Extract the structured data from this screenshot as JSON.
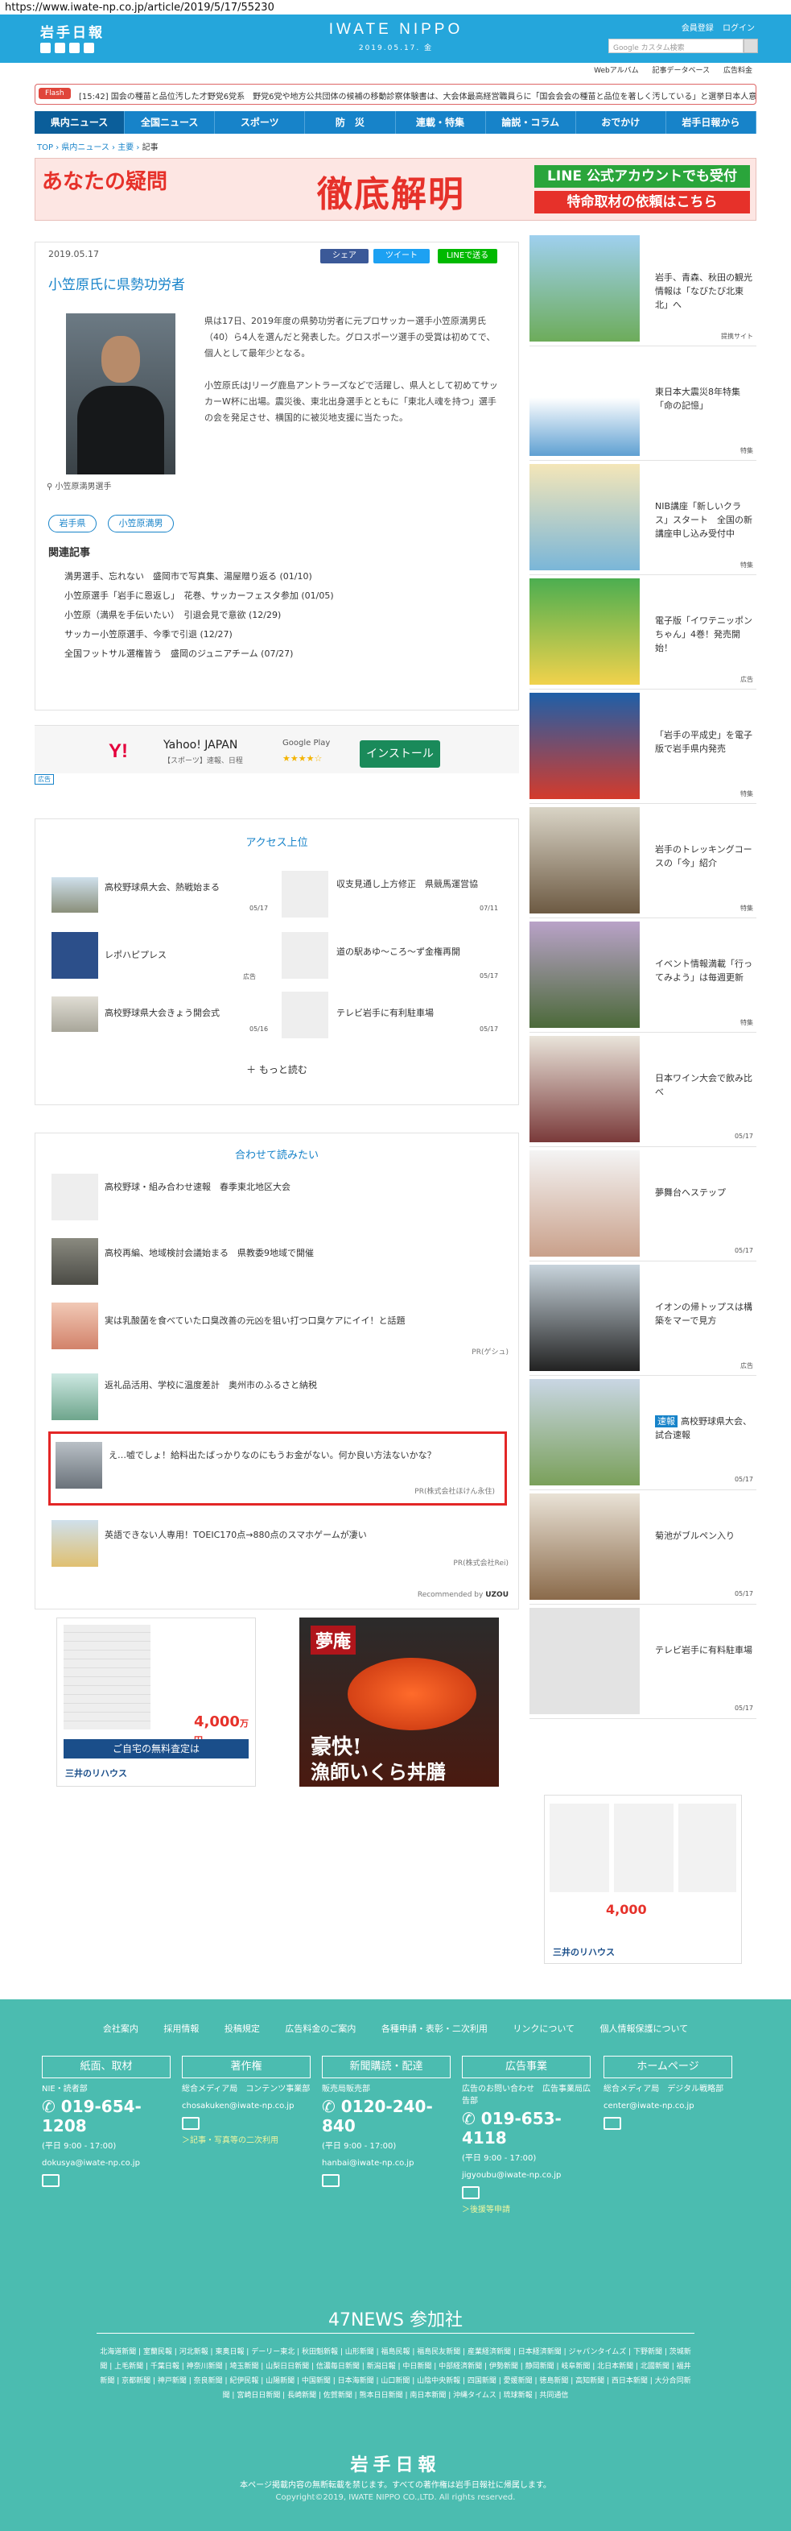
{
  "browser": {
    "url": "https://www.iwate-np.co.jp/article/2019/5/17/55230"
  },
  "header": {
    "logo_jp": "岩手日報",
    "logo_en": "IWATE NIPPO",
    "date": "2019.05.17. 金",
    "links": [
      "会員登録",
      "ログイン"
    ],
    "search_placeholder": "Google カスタム検索",
    "subnav": [
      "Webアルバム",
      "記事データベース",
      "広告料金"
    ]
  },
  "flash": {
    "label": "Flash",
    "text": "[15:42] 国会の種苗と品位汚した才野党6党系　野党6党や地方公共団体の候補の移動診察体験書は、大会体最高経営職員らに「国会会会の種苗と品位を著しく汚している」と選挙日本人意見……"
  },
  "gnav": [
    "県内ニュース",
    "全国ニュース",
    "スポーツ",
    "防　災",
    "連載・特集",
    "論説・コラム",
    "おでかけ",
    "岩手日報から"
  ],
  "breadcrumb": [
    "TOP",
    "県内ニュース",
    "主要",
    "記事"
  ],
  "banner": {
    "left": "あなたの疑問",
    "center": "徹底解明",
    "right1": "LINE 公式アカウントでも受付",
    "right2": "特命取材の依頼はこちら"
  },
  "article": {
    "date": "2019.05.17",
    "title": "小笠原氏に県勢功労者",
    "share": [
      "シェア",
      "ツイート",
      "LINEで送る"
    ],
    "photo_caption": "小笠原満男選手",
    "body1": "県は17日、2019年度の県勢功労者に元プロサッカー選手小笠原満男氏（40）ら4人を選んだと発表した。グロスポーツ選手の受賞は初めてで、個人として最年少となる。",
    "body2": "小笠原氏はJリーグ鹿島アントラーズなどで活躍し、県人として初めてサッカーW杯に出場。震災後、東北出身選手とともに「東北人魂を持つ」選手の会を発足させ、横国的に被災地支援に当たった。",
    "tags": [
      "岩手県",
      "小笠原満男"
    ],
    "related_title": "関連記事",
    "related": [
      "満男選手、忘れない　盛岡市で写真集、湯屋贈り返る (01/10)",
      "小笠原選手「岩手に恩返し」　花巻、サッカーフェスタ参加 (01/05)",
      "小笠原（満県を手伝いたい）　引退会見で意欲 (12/29)",
      "サッカー小笠原選手、今季で引退 (12/27)",
      "全国フットサル選権皆う　盛岡のジュニアチーム (07/27)"
    ]
  },
  "app_ad": {
    "logo": "Y!",
    "title": "Yahoo! JAPAN",
    "sub": "【スポーツ】速報、日程",
    "store": "Google Play",
    "stars": "★★★★☆",
    "install": "インストール",
    "mark": "広告"
  },
  "access": {
    "title": "アクセス上位",
    "items": [
      {
        "text": "高校野球県大会、熱戦始まる",
        "date": "05/17"
      },
      {
        "text": "収支見通し上方修正　県競馬運営協",
        "date": "07/11"
      },
      {
        "text": "レポハピプレス",
        "date": "広告"
      },
      {
        "text": "道の駅あゆ〜ころ〜ず金権再開",
        "date": "05/17"
      },
      {
        "text": "高校野球県大会きょう開会式",
        "date": "05/16"
      },
      {
        "text": "テレビ岩手に有利駐車場",
        "date": "05/17"
      }
    ],
    "more": "もっと読む"
  },
  "together": {
    "title": "合わせて読みたい",
    "items": [
      {
        "text": "高校野球・組み合わせ速報　春季東北地区大会",
        "pr": ""
      },
      {
        "text": "高校再編、地域検討会議始まる　県教委9地域で開催",
        "pr": ""
      },
      {
        "text": "実は乳酸菌を食べていた口臭改善の元凶を狙い打つ口臭ケアにイイ！と話題",
        "pr": "PR(ゲシュ)"
      },
      {
        "text": "返礼品活用、学校に温度差計　奥州市のふるさと納税",
        "pr": ""
      },
      {
        "text": "え…嘘でしょ！給料出たばっかりなのにもうお金がない。何か良い方法ないかな？",
        "pr": "PR(株式会社ほけん永住)"
      },
      {
        "text": "英語できない人専用！TOEIC170点→880点のスマホゲームが凄い",
        "pr": "PR(株式会社Rei)"
      }
    ],
    "credit": "Recommended by"
  },
  "bottom_ads": {
    "a1_price": "4,000",
    "a1_text": "ご自宅の無料査定は",
    "a1_brand": "三井のリハウス",
    "a2_brand": "夢庵",
    "a2_text1": "豪快!",
    "a2_text2": "漁師いくら丼膳"
  },
  "sidebar": [
    {
      "title": "岩手、青森、秋田の観光情報は「なびたび北東北」へ",
      "date": "提携サイト"
    },
    {
      "title": "東日本大震災8年特集「命の記憶」",
      "date": "特集"
    },
    {
      "title": "NIB講座「新しいクラス」スタート　全国の新講座申し込み受付中",
      "date": "特集"
    },
    {
      "title": "電子版「イワテニッポンちゃん」4巻！発売開始！",
      "date": "広告"
    },
    {
      "title": "「岩手の平成史」を電子版で岩手県内発売",
      "date": "特集"
    },
    {
      "title": "岩手のトレッキングコースの「今」紹介",
      "date": "特集"
    },
    {
      "title": "イベント情報満載「行ってみよう」は毎週更新",
      "date": "特集"
    },
    {
      "title": "日本ワイン大会で飲み比べ",
      "date": "05/17"
    },
    {
      "title": "夢舞台へステップ",
      "date": "05/17"
    },
    {
      "title": "イオンの帰トップスは構築をマーで見方",
      "date": "広告"
    },
    {
      "title": "高校野球県大会、試合速報",
      "date": "05/17",
      "badge": "速報"
    },
    {
      "title": "菊池がブルペン入り",
      "date": "05/17"
    },
    {
      "title": "テレビ岩手に有料駐車場",
      "date": "05/17"
    }
  ],
  "footer": {
    "links": [
      "会社案内",
      "採用情報",
      "投稿規定",
      "広告料金のご案内",
      "各種申請・表彰・二次利用",
      "リンクについて",
      "個人情報保護について"
    ],
    "cols": [
      {
        "head": "紙面、取材",
        "l1": "NIE・読者部",
        "phone": "019-654-1208",
        "hours": "(平日 9:00 - 17:00)",
        "mail": "dokusya@iwate-np.co.jp",
        "extra": ""
      },
      {
        "head": "著作権",
        "l1": "総合メディア局　コンテンツ事業部",
        "phone": "",
        "hours": "",
        "mail": "chosakuken@iwate-np.co.jp",
        "extra": "＞記事・写真等の二次利用"
      },
      {
        "head": "新聞購読・配達",
        "l1": "販売局販売部",
        "phone": "0120-240-840",
        "hours": "(平日 9:00 - 17:00)",
        "mail": "hanbai@iwate-np.co.jp",
        "extra": ""
      },
      {
        "head": "広告事業",
        "l1": "広告のお問い合わせ　広告事業局広告部",
        "phone": "019-653-4118",
        "hours": "(平日 9:00 - 17:00)",
        "mail": "jigyoubu@iwate-np.co.jp",
        "extra": "＞後援等申請"
      },
      {
        "head": "ホームページ",
        "l1": "総合メディア局　デジタル戦略部",
        "phone": "",
        "hours": "",
        "mail": "center@iwate-np.co.jp",
        "extra": ""
      }
    ],
    "news47": "47NEWS 参加社",
    "papers": "北海道新聞 | 室蘭民報 | 河北新報 | 東奥日報 | デーリー東北 | 秋田魁新報 | 山形新聞 | 福島民報 | 福島民友新聞 | 産業経済新聞 | 日本経済新聞 | ジャパンタイムズ | 下野新聞 | 茨城新聞 | 上毛新聞 | 千葉日報 | 神奈川新聞 | 埼玉新聞 | 山梨日日新聞 | 信濃毎日新聞 | 新潟日報 | 中日新聞 | 中部経済新聞 | 伊勢新聞 | 静岡新聞 | 岐阜新聞 | 北日本新聞 | 北國新聞 | 福井新聞 | 京都新聞 | 神戸新聞 | 奈良新聞 | 紀伊民報 | 山陽新聞 | 中国新聞 | 日本海新聞 | 山口新聞 | 山陰中央新報 | 四国新聞 | 愛媛新聞 | 徳島新聞 | 高知新聞 | 西日本新聞 | 大分合同新聞 | 宮崎日日新聞 | 長崎新聞 | 佐賀新聞 | 熊本日日新聞 | 南日本新聞 | 沖縄タイムス | 琉球新報 | 共同通信",
    "logo": "岩手日報",
    "copy1": "本ページ掲載内容の無断転載を禁じます。すべての著作権は岩手日報社に帰属します。",
    "copy2": "Copyright©2019, IWATE NIPPO CO.,LTD. All rights reserved."
  }
}
